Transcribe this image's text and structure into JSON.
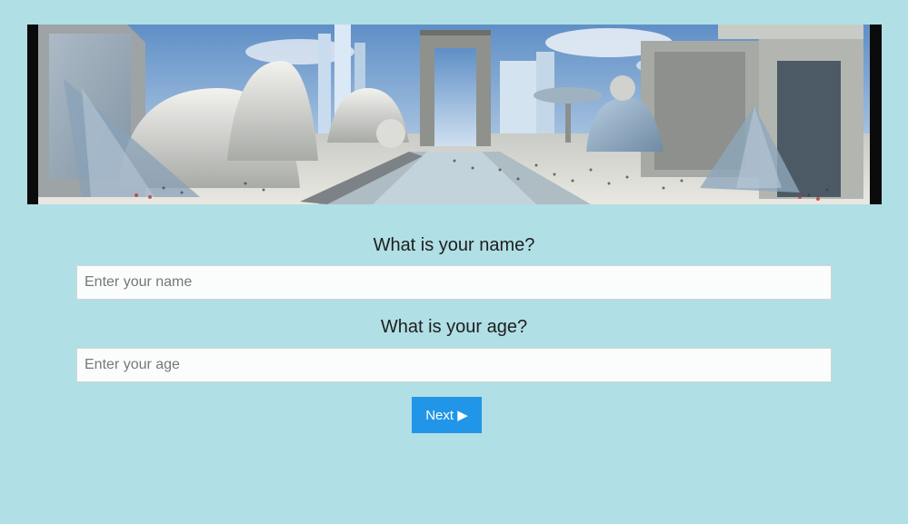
{
  "banner": {
    "image": "futuristic-city-plaza"
  },
  "form": {
    "name_question": "What is your name?",
    "name_placeholder": "Enter your name",
    "name_value": "",
    "age_question": "What is your age?",
    "age_placeholder": "Enter your age",
    "age_value": "",
    "next_label": "Next ▶"
  },
  "colors": {
    "background": "#b0dfe5",
    "button": "#2196e8",
    "button_text": "#ffffff"
  }
}
